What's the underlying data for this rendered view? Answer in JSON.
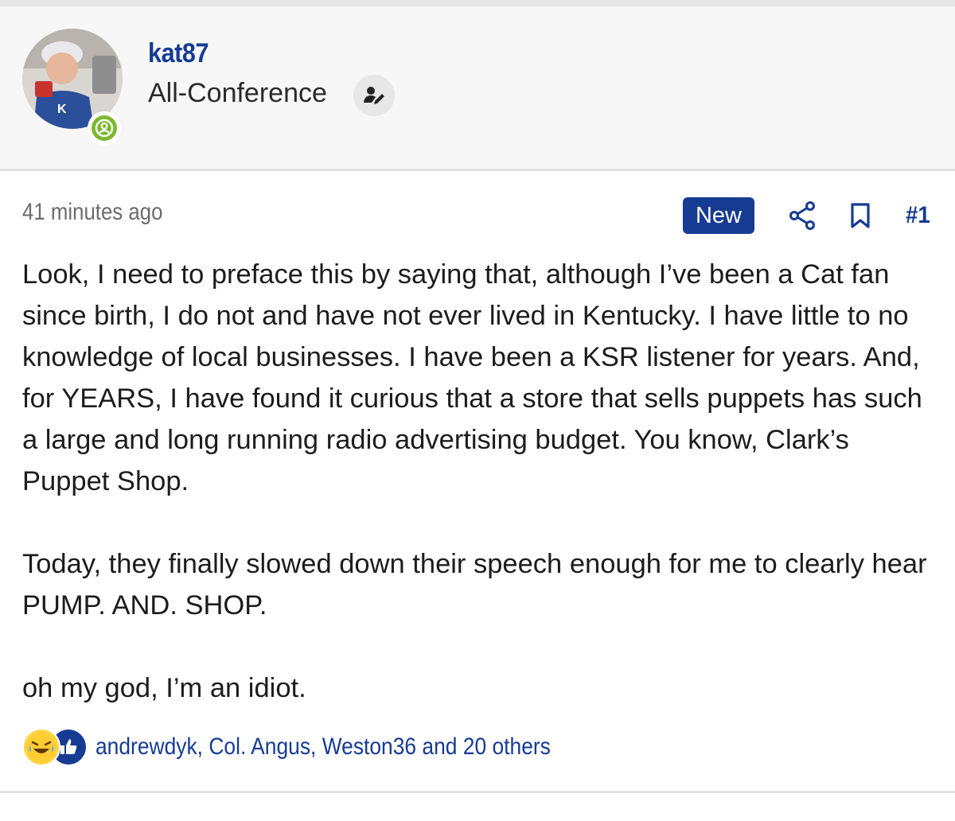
{
  "author": {
    "username": "kat87",
    "user_title": "All-Conference",
    "avatar_icon": "user-avatar-photo",
    "presence_icon": "online-status-icon",
    "presence_color": "#7bb830",
    "title_edit_icon": "user-edit-icon"
  },
  "post": {
    "time_ago": "41 minutes ago",
    "new_badge": "New",
    "share_icon": "share-icon",
    "bookmark_icon": "bookmark-icon",
    "post_number": "#1",
    "paragraphs": [
      "Look, I need to preface this by saying that, although I’ve been a Cat fan since birth, I do not and have not ever lived in Kentucky. I have little to no knowledge of local businesses. I have been a KSR listener for years. And, for YEARS, I have found it curious that a store that sells puppets has such a large and long running radio advertising budget. You know, Clark’s Puppet Shop.",
      "Today, they finally slowed down their speech enough for me to clearly hear PUMP. AND. SHOP.",
      "oh my god, I’m an idiot."
    ]
  },
  "reactions": {
    "icons": [
      "laughing-emoji-icon",
      "thumbs-up-icon"
    ],
    "users_text": "andrewdyk, Col. Angus, Weston36 and 20 others"
  },
  "colors": {
    "accent": "#163b93",
    "header_bg": "#f7f7f7",
    "muted_text": "#6b6b6b"
  }
}
